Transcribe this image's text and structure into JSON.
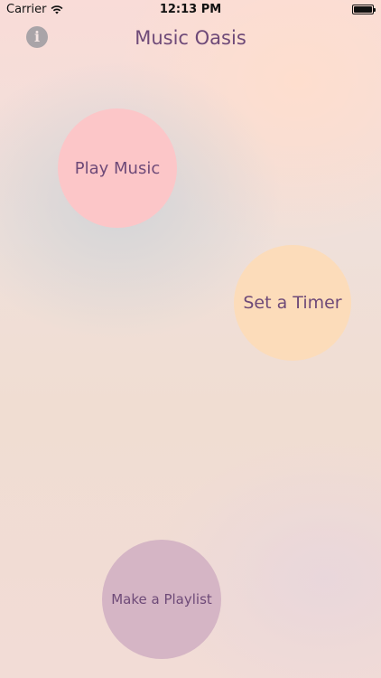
{
  "status_bar": {
    "carrier": "Carrier",
    "time": "12:13 PM",
    "battery_level": 1.0
  },
  "header": {
    "title": "Music Oasis",
    "info_glyph": "i"
  },
  "menu": {
    "play_music_label": "Play Music",
    "set_timer_label": "Set a Timer",
    "make_playlist_label": "Make a Playlist"
  },
  "colors": {
    "accent_text": "#6e4a78",
    "play_music_bg": "#fcc6c8",
    "set_timer_bg": "#fcdcba",
    "make_playlist_bg": "#d5b5c5",
    "info_icon": "#a9a4a8"
  },
  "icons": {
    "info": "info-icon",
    "wifi": "wifi-icon",
    "battery": "battery-icon"
  }
}
